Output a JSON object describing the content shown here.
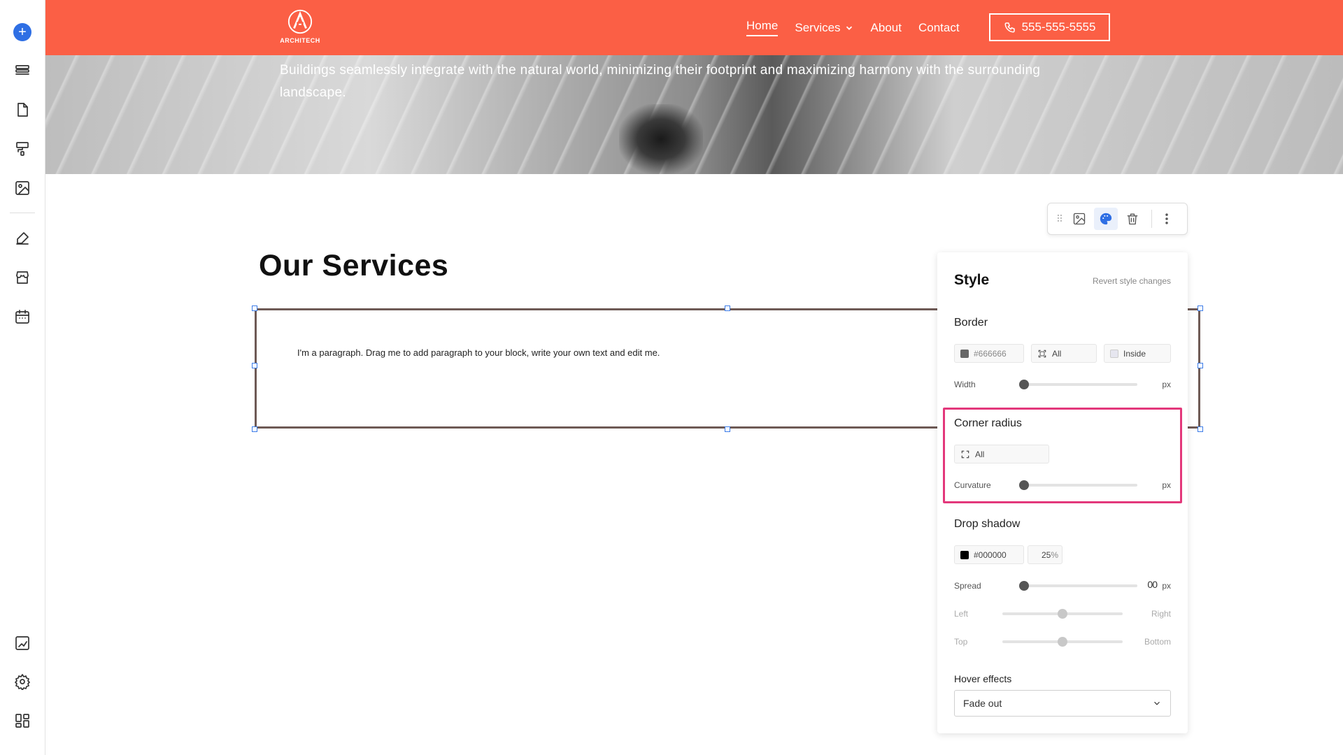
{
  "header": {
    "logo_text": "ARCHITECH",
    "nav": [
      {
        "label": "Home"
      },
      {
        "label": "Services"
      },
      {
        "label": "About"
      },
      {
        "label": "Contact"
      }
    ],
    "phone": "555-555-5555"
  },
  "hero": {
    "text": "Buildings seamlessly integrate with the natural world, minimizing their footprint and maximizing harmony with the surrounding landscape."
  },
  "content": {
    "section_title": "Our Services",
    "paragraph": "I'm a paragraph. Drag me to add paragraph to your block, write your own text and edit me."
  },
  "panel": {
    "title": "Style",
    "revert": "Revert style changes",
    "border": {
      "label": "Border",
      "color_value": "#666666",
      "color_swatch": "#666666",
      "sides": "All",
      "position": "Inside",
      "width_label": "Width",
      "unit": "px"
    },
    "corner": {
      "label": "Corner radius",
      "sides": "All",
      "curvature_label": "Curvature",
      "unit": "px"
    },
    "shadow": {
      "label": "Drop shadow",
      "color_value": "#000000",
      "color_swatch": "#000000",
      "opacity": "25",
      "opacity_unit": "%",
      "spread_label": "Spread",
      "spread_value": "00",
      "unit": "px",
      "left_label": "Left",
      "right_label": "Right",
      "top_label": "Top",
      "bottom_label": "Bottom"
    },
    "hover": {
      "label": "Hover effects",
      "value": "Fade out"
    }
  },
  "colors": {
    "header_bg": "#fb5f45",
    "accent": "#2f6fe4",
    "highlight": "#e3387b"
  }
}
